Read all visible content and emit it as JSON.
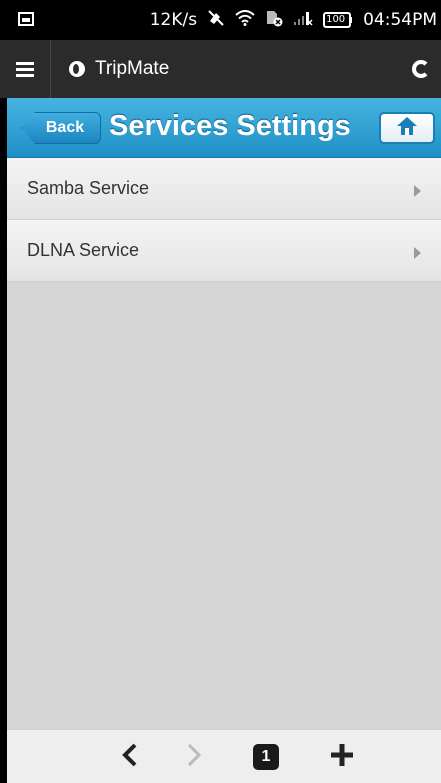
{
  "status_bar": {
    "net_speed": "12K/s",
    "battery": "100",
    "time": "04:54PM",
    "icons": [
      "screenshot-icon",
      "mute-icon",
      "wifi-icon",
      "sim-off-icon",
      "signal-icon",
      "battery-icon"
    ]
  },
  "toolbar": {
    "app_name": "TripMate",
    "icons": [
      "menu-icon",
      "app-logo-icon",
      "refresh-icon"
    ]
  },
  "header": {
    "back_label": "Back",
    "title": "Services Settings",
    "home_icon": "home-icon",
    "accent_color": "#2a9fd6"
  },
  "services": [
    {
      "label": "Samba Service"
    },
    {
      "label": "DLNA Service"
    }
  ],
  "bottom_bar": {
    "tabs_count": "1",
    "icons": [
      "back-arrow-icon",
      "forward-arrow-icon",
      "tabs-icon",
      "new-tab-icon"
    ]
  }
}
